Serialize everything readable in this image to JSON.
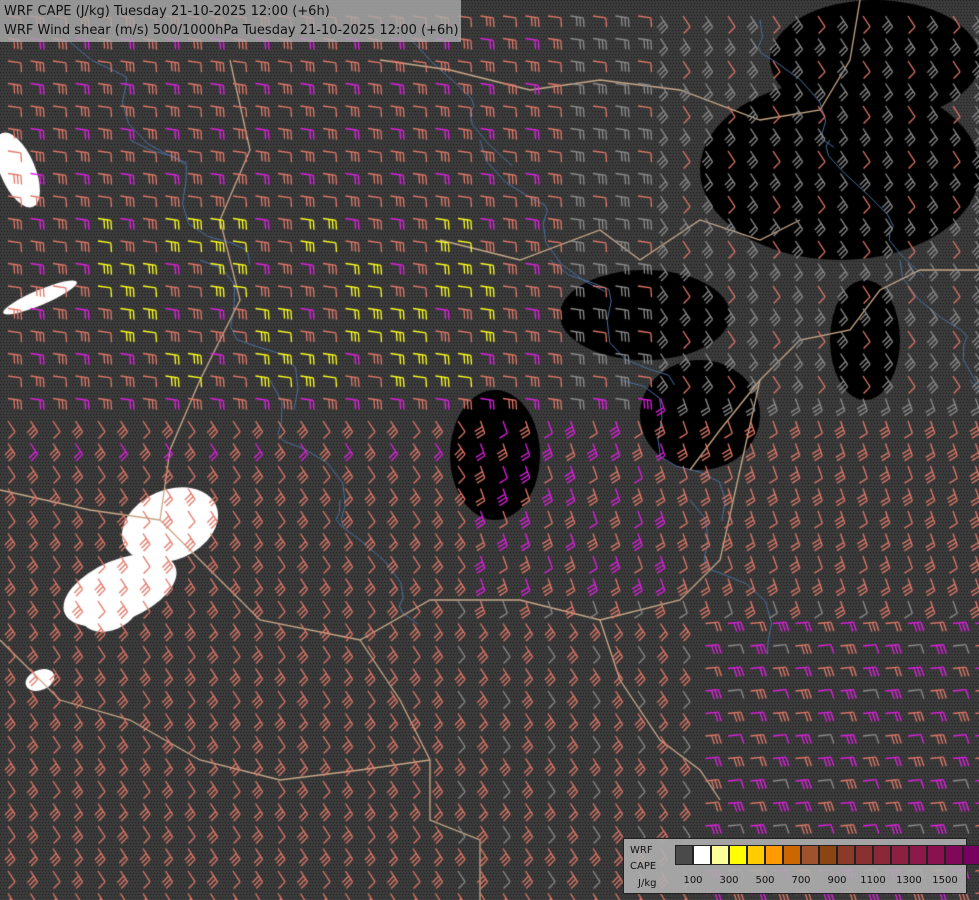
{
  "header": {
    "line1": "WRF CAPE (J/kg) Tuesday 21-10-2025 12:00 (+6h)",
    "line2": "WRF Wind shear (m/s) 500/1000hPa Tuesday 21-10-2025 12:00 (+6h)"
  },
  "legend": {
    "title_line1": "WRF",
    "title_line2": "CAPE",
    "unit": "J/kg",
    "colors": [
      "#4a4a4a",
      "#ffffff",
      "#ffff99",
      "#ffff00",
      "#ffcc00",
      "#ff9900",
      "#cc6600",
      "#a0522d",
      "#8b4513",
      "#8b3a2a",
      "#8b3030",
      "#8b2838",
      "#8b2040",
      "#8b1a48",
      "#8b1050",
      "#800858",
      "#780060"
    ],
    "tick_labels": [
      "100",
      "300",
      "500",
      "700",
      "900",
      "1100",
      "1300",
      "1500"
    ]
  },
  "map": {
    "background": "#3c3c3c",
    "barb_colors": {
      "low": "#8c8c8c",
      "mid": "#e07868",
      "high": "#e020e0",
      "very_high": "#ffff20"
    },
    "border_color": "#c8a888",
    "river_color": "#4a6fa0"
  }
}
